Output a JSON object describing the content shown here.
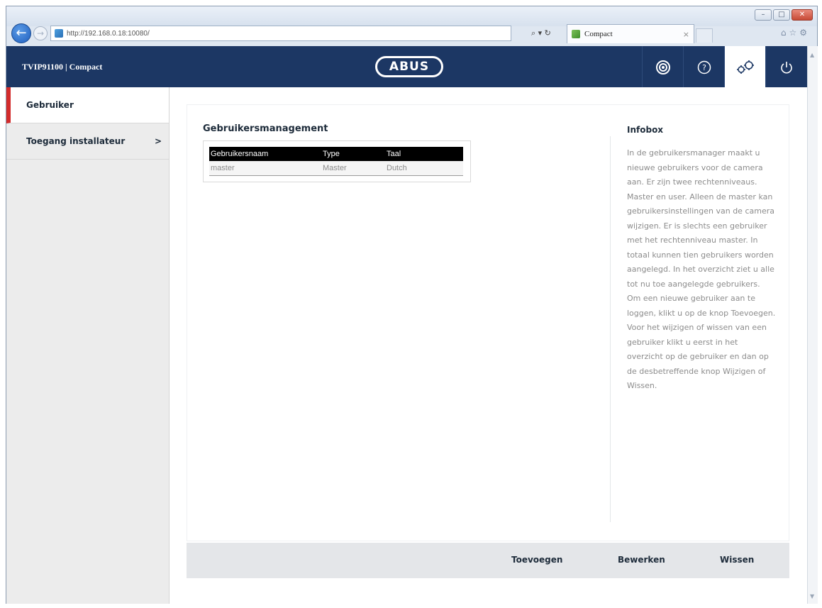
{
  "browser": {
    "url": "http://192.168.0.18:10080/",
    "address_tools": "⌕ ▾ ↻",
    "tab_title": "Compact",
    "tab_close": "×",
    "window_controls": [
      "–",
      "□",
      "✕"
    ],
    "toolbar_icons": [
      "home-icon",
      "star-icon",
      "gear-icon"
    ]
  },
  "header": {
    "device_title": "TVIP91100 | Compact",
    "brand": "ABUS",
    "buttons": [
      {
        "name": "camera-icon",
        "active": false
      },
      {
        "name": "help-icon",
        "active": false
      },
      {
        "name": "settings-icon",
        "active": true
      },
      {
        "name": "power-icon",
        "active": false
      }
    ]
  },
  "sidebar": {
    "items": [
      {
        "label": "Gebruiker",
        "active": true
      },
      {
        "label": "Toegang installateur",
        "chevron": ">"
      }
    ]
  },
  "main": {
    "title": "Gebruikersmanagement",
    "table": {
      "headers": [
        "Gebruikersnaam",
        "Type",
        "Taal"
      ],
      "rows": [
        [
          "master",
          "Master",
          "Dutch"
        ]
      ]
    },
    "infobox": {
      "title": "Infobox",
      "text": "In de gebruikersmanager maakt u nieuwe gebruikers voor de camera aan. Er zijn twee rechtenniveaus. Master en user. Alleen de master kan gebruikersinstellingen van de camera wijzigen. Er is slechts een gebruiker met het rechtenniveau master. In totaal kunnen tien gebruikers worden aangelegd. In het overzicht ziet u alle tot nu toe aangelegde gebruikers. Om een nieuwe gebruiker aan te loggen, klikt u op de knop Toevoegen. Voor het wijzigen of wissen van een gebruiker klikt u eerst in het overzicht op de gebruiker en dan op de desbetreffende knop Wijzigen of Wissen."
    }
  },
  "actions": {
    "add": "Toevoegen",
    "edit": "Bewerken",
    "delete": "Wissen"
  },
  "colors": {
    "header_bg": "#1c3764",
    "active_accent": "#d22b2b",
    "sidebar_bg": "#ececec",
    "action_bar_bg": "#e4e6e9"
  }
}
